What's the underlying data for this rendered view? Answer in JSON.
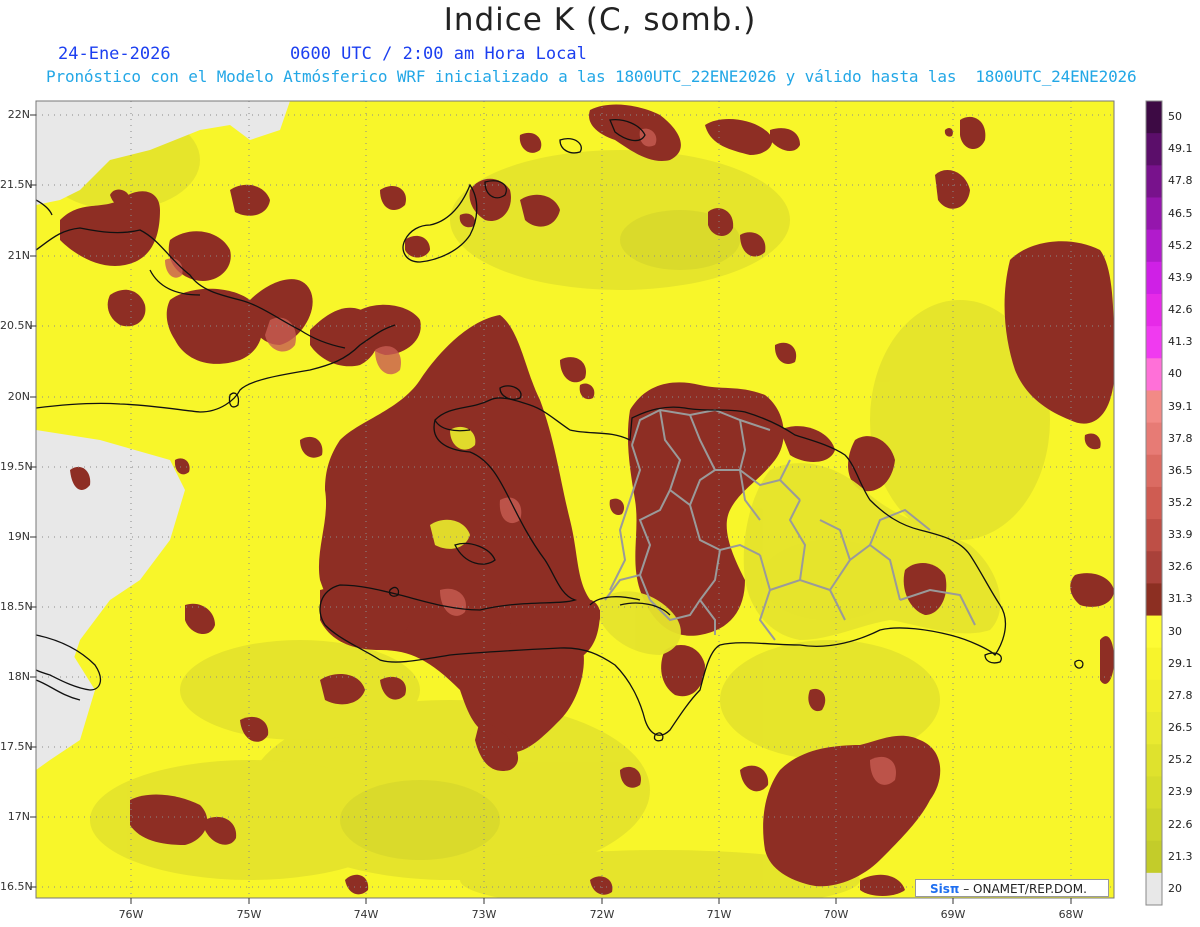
{
  "header": {
    "title": "Indice K (C, somb.)",
    "date": "24-Ene-2026",
    "time": "0600 UTC / 2:00 am Hora Local",
    "description": "Pronóstico con el Modelo Atmósferico WRF inicializado a las 1800UTC_22ENE2026 y válido hasta las  1800UTC_24ENE2026"
  },
  "axes": {
    "lat_labels": [
      "22N",
      "21.5N",
      "21N",
      "20.5N",
      "20N",
      "19.5N",
      "19N",
      "18.5N",
      "18N",
      "17.5N",
      "17N",
      "16.5N"
    ],
    "lon_labels": [
      "76W",
      "75W",
      "74W",
      "73W",
      "72W",
      "71W",
      "70W",
      "69W",
      "68W"
    ]
  },
  "colorbar": {
    "labels": [
      "50",
      "49.1",
      "47.8",
      "46.5",
      "45.2",
      "43.9",
      "42.6",
      "41.3",
      "40",
      "39.1",
      "37.8",
      "36.5",
      "35.2",
      "33.9",
      "32.6",
      "31.3",
      "30",
      "29.1",
      "27.8",
      "26.5",
      "25.2",
      "23.9",
      "22.6",
      "21.3",
      "20"
    ],
    "colors": [
      "#3d0a44",
      "#5b0e6a",
      "#78128c",
      "#9516ad",
      "#b11bcc",
      "#cf20e6",
      "#e62ae8",
      "#f03af0",
      "#ff70d8",
      "#f28a86",
      "#e77b75",
      "#db6b62",
      "#cf5c52",
      "#be4f46",
      "#a9413a",
      "#8c2f22",
      "#fdfb34",
      "#f7f42c",
      "#f1ef2e",
      "#e9ea30",
      "#dfe22d",
      "#d6dc2c",
      "#ccd42c",
      "#c3cc2a",
      "#e8e8e8"
    ]
  },
  "credit": {
    "logo": "Sisπ",
    "text": " – ONAMET/REP.DOM."
  }
}
